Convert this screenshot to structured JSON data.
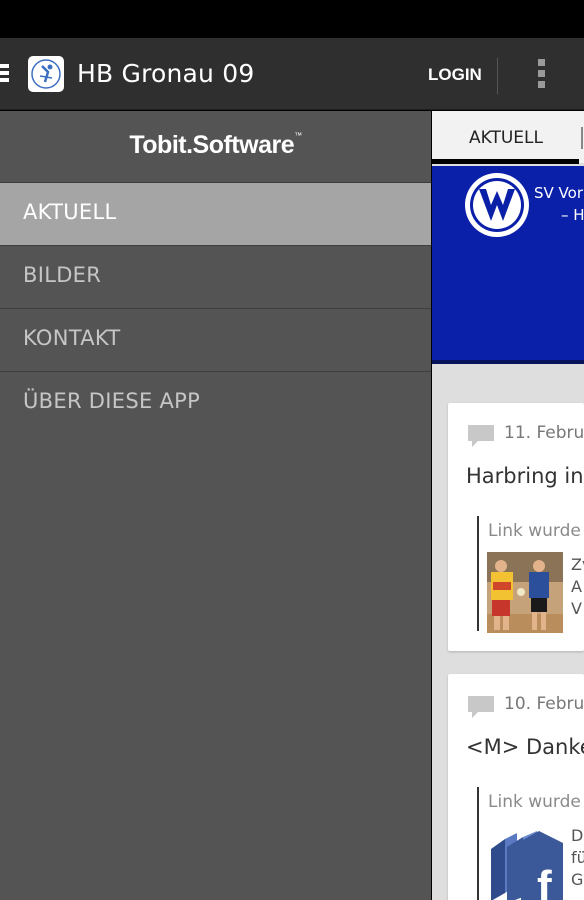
{
  "actionbar": {
    "title": "HB Gronau 09",
    "login_label": "LOGIN"
  },
  "drawer": {
    "brand": "Tobit.Software",
    "brand_mark": "™",
    "items": [
      {
        "label": "AKTUELL",
        "active": true
      },
      {
        "label": "BILDER",
        "active": false
      },
      {
        "label": "KONTAKT",
        "active": false
      },
      {
        "label": "ÜBER DIESE APP",
        "active": false
      }
    ]
  },
  "content": {
    "tab": "AKTUELL",
    "banner": {
      "line1": "SV Vor",
      "line2": "– Ha"
    },
    "cards": [
      {
        "date": "11. Febru",
        "title": "Harbring in",
        "link": "Link wurde",
        "side_lines": [
          "Zv",
          "A",
          "V"
        ]
      },
      {
        "date": "10. Febru",
        "title": "<M> Danke",
        "link": "Link wurde",
        "side_lines": [
          "D",
          "fü",
          "G"
        ]
      }
    ]
  },
  "colors": {
    "actionbar": "#2f2f2f",
    "drawer": "#545454",
    "drawer_active": "#a5a5a5",
    "banner": "#0b20a8"
  }
}
